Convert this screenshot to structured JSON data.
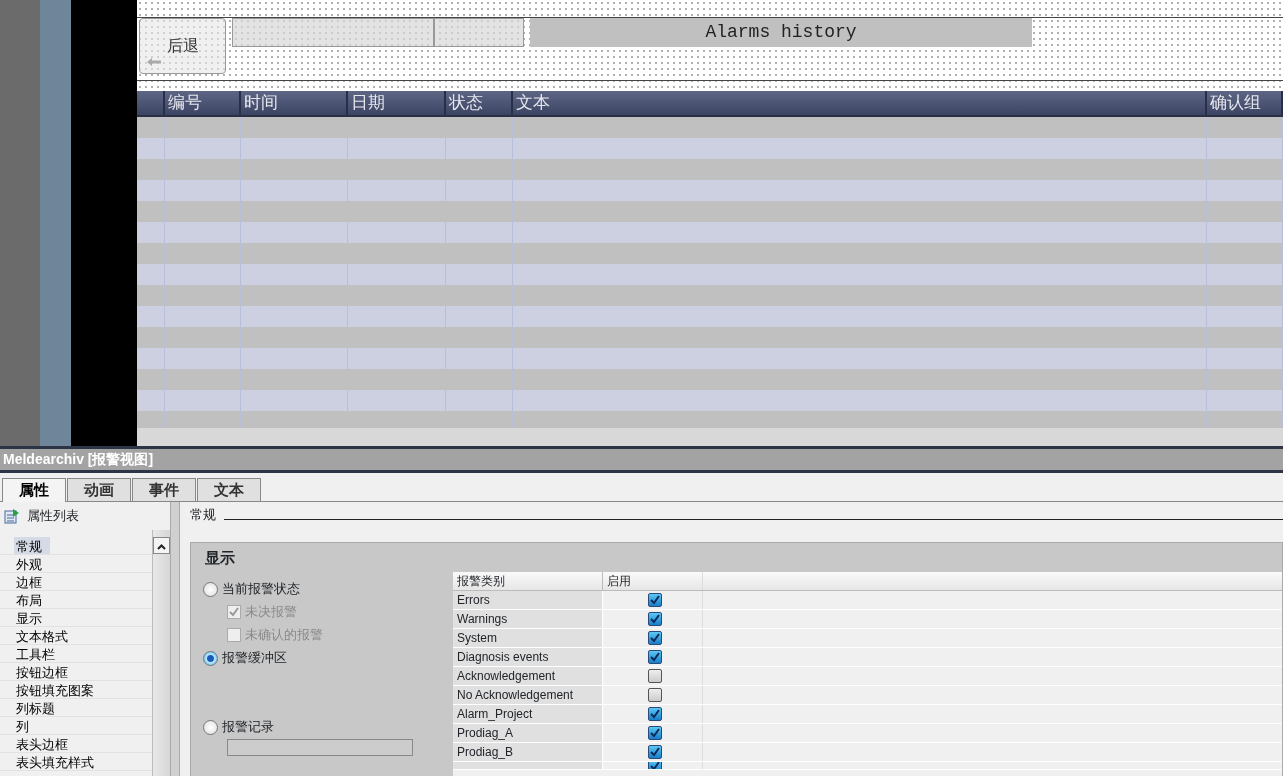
{
  "screen": {
    "back_button": {
      "label": "后退"
    },
    "title": "Alarms history"
  },
  "alarm_table": {
    "columns": [
      {
        "label": "编号"
      },
      {
        "label": "时间"
      },
      {
        "label": "日期"
      },
      {
        "label": "状态"
      },
      {
        "label": "文本"
      },
      {
        "label": "确认组"
      }
    ]
  },
  "inspector": {
    "title": "Meldearchiv [报警视图]",
    "tabs": [
      {
        "label": "属性",
        "selected": true
      },
      {
        "label": "动画",
        "selected": false
      },
      {
        "label": "事件",
        "selected": false
      },
      {
        "label": "文本",
        "selected": false
      }
    ],
    "sidebar": {
      "header": "属性列表",
      "items": [
        {
          "label": "常规",
          "selected": true
        },
        {
          "label": "外观",
          "selected": false
        },
        {
          "label": "边框",
          "selected": false
        },
        {
          "label": "布局",
          "selected": false
        },
        {
          "label": "显示",
          "selected": false
        },
        {
          "label": "文本格式",
          "selected": false
        },
        {
          "label": "工具栏",
          "selected": false
        },
        {
          "label": "按钮边框",
          "selected": false
        },
        {
          "label": "按钮填充图案",
          "selected": false
        },
        {
          "label": "列标题",
          "selected": false
        },
        {
          "label": "列",
          "selected": false
        },
        {
          "label": "表头边框",
          "selected": false
        },
        {
          "label": "表头填充样式",
          "selected": false
        }
      ]
    },
    "section_title": "常规",
    "group": {
      "title": "显示",
      "options": [
        {
          "kind": "radio",
          "label": "当前报警状态",
          "selected": false
        },
        {
          "kind": "checkbox",
          "label": "未决报警",
          "checked": true,
          "disabled": true
        },
        {
          "kind": "checkbox",
          "label": "未确认的报警",
          "checked": false,
          "disabled": true
        },
        {
          "kind": "radio",
          "label": "报警缓冲区",
          "selected": true
        },
        {
          "kind": "radio",
          "label": "报警记录",
          "selected": false
        }
      ],
      "class_table": {
        "columns": [
          "报警类别",
          "启用"
        ],
        "rows": [
          {
            "category": "Errors",
            "enabled": true
          },
          {
            "category": "Warnings",
            "enabled": true
          },
          {
            "category": "System",
            "enabled": true
          },
          {
            "category": "Diagnosis events",
            "enabled": true
          },
          {
            "category": "Acknowledgement",
            "enabled": false
          },
          {
            "category": "No Acknowledgement",
            "enabled": false
          },
          {
            "category": "Alarm_Project",
            "enabled": true
          },
          {
            "category": "Prodiag_A",
            "enabled": true
          },
          {
            "category": "Prodiag_B",
            "enabled": true
          },
          {
            "enabled": true
          }
        ]
      }
    }
  }
}
